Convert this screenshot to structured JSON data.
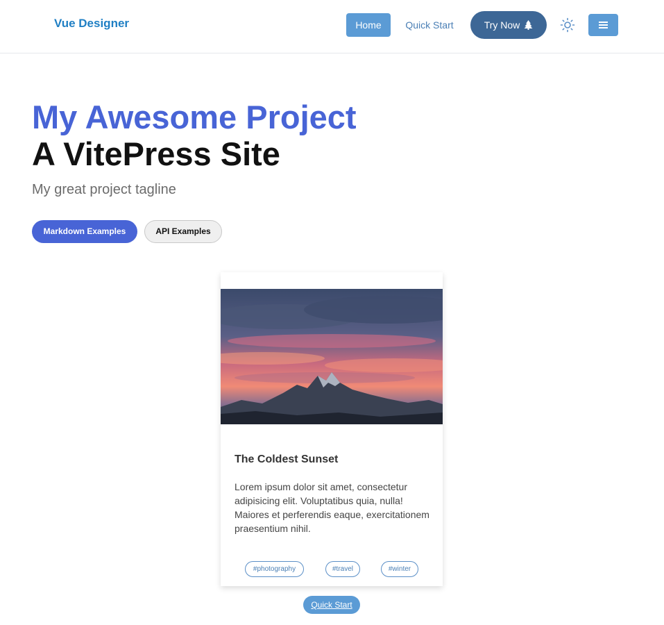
{
  "nav": {
    "logo": "Vue Designer",
    "home": "Home",
    "quick_start": "Quick Start",
    "try_now": "Try Now",
    "theme_icon": "sun-icon",
    "menu_icon": "hamburger-icon"
  },
  "hero": {
    "name": "My Awesome Project",
    "text": "A VitePress Site",
    "tagline": "My great project tagline",
    "actions": [
      "Markdown Examples",
      "API Examples"
    ]
  },
  "card": {
    "title": "The Coldest Sunset",
    "body": "Lorem ipsum dolor sit amet, consectetur adipisicing elit. Voluptatibus quia, nulla! Maiores et perferendis eaque, exercitationem praesentium nihil.",
    "tags": [
      "#photography",
      "#travel",
      "#winter"
    ]
  },
  "footer": {
    "quick_start": "Quick Start"
  },
  "colors": {
    "brand": "#4864d6",
    "nav_button": "#5b9bd5",
    "try_now": "#3d6796"
  }
}
